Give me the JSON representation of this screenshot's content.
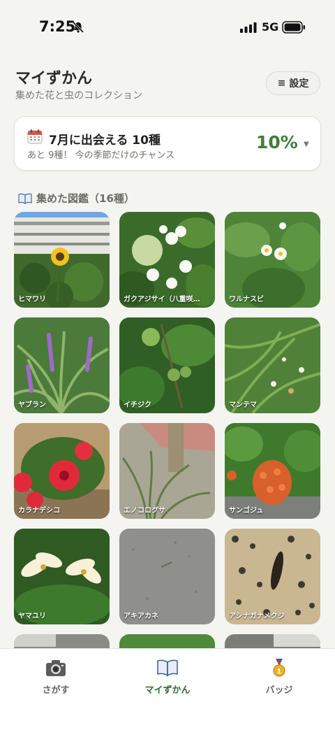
{
  "status": {
    "time": "7:25",
    "network": "5G"
  },
  "header": {
    "title": "マイずかん",
    "subtitle": "集めた花と虫のコレクション",
    "settings_label": "設定"
  },
  "season_card": {
    "headline": "7月に出会える 10種",
    "sub": "あと 9種！ 今の季節だけのチャンス",
    "percent": "10%"
  },
  "collection": {
    "heading": "集めた図鑑（16種）",
    "items": [
      {
        "label": "ヒマワリ"
      },
      {
        "label": "ガクアジサイ（八重咲…"
      },
      {
        "label": "ワルナスビ"
      },
      {
        "label": "ヤブラン"
      },
      {
        "label": "イチジク"
      },
      {
        "label": "マンテマ"
      },
      {
        "label": "カラナデシコ"
      },
      {
        "label": "エノコログサ"
      },
      {
        "label": "サンゴジュ"
      },
      {
        "label": "ヤマユリ"
      },
      {
        "label": "アキアカネ"
      },
      {
        "label": "アシナガナメクジ"
      },
      {
        "label": ""
      },
      {
        "label": ""
      },
      {
        "label": ""
      }
    ]
  },
  "tabs": [
    {
      "label": "さがす",
      "icon": "camera-icon"
    },
    {
      "label": "マイずかん",
      "icon": "book-icon"
    },
    {
      "label": "バッジ",
      "icon": "medal-icon"
    }
  ],
  "colors": {
    "accent": "#3f7d3a",
    "background": "#f4f5f1"
  }
}
